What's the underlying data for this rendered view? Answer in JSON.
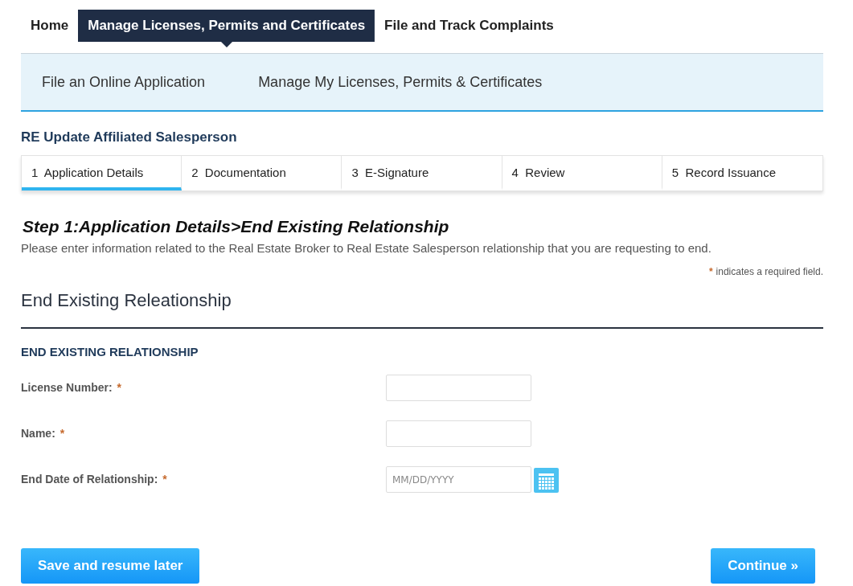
{
  "top_nav": [
    {
      "label": "Home",
      "selected": false
    },
    {
      "label": "Manage Licenses, Permits and Certificates",
      "selected": true
    },
    {
      "label": "File and Track Complaints",
      "selected": false
    }
  ],
  "sub_nav": [
    {
      "label": "File an Online Application"
    },
    {
      "label": "Manage My Licenses, Permits & Certificates"
    }
  ],
  "page_title": "RE Update Affiliated Salesperson",
  "steps": [
    {
      "number": "1",
      "label": "Application Details",
      "selected": true
    },
    {
      "number": "2",
      "label": "Documentation",
      "selected": false
    },
    {
      "number": "3",
      "label": "E-Signature",
      "selected": false
    },
    {
      "number": "4",
      "label": "Review",
      "selected": false
    },
    {
      "number": "5",
      "label": "Record Issuance",
      "selected": false
    }
  ],
  "step_heading": "Step 1:Application Details>End Existing Relationship",
  "description": "Please enter information related to the Real Estate Broker to Real Estate Salesperson relationship that you are requesting to end.",
  "required_note": {
    "mark": "*",
    "text": "indicates a required field."
  },
  "section_title": "End Existing Releationship",
  "subsection_title": "END EXISTING RELATIONSHIP",
  "fields": [
    {
      "label": "License Number:",
      "required_mark": "*",
      "kind": "text"
    },
    {
      "label": "Name:",
      "required_mark": "*",
      "kind": "text"
    },
    {
      "label": "End Date of Relationship:",
      "required_mark": "*",
      "kind": "date",
      "placeholder": "MM/DD/YYYY"
    }
  ],
  "buttons": [
    {
      "label": "Save and resume later"
    },
    {
      "label": "Continue »"
    }
  ]
}
